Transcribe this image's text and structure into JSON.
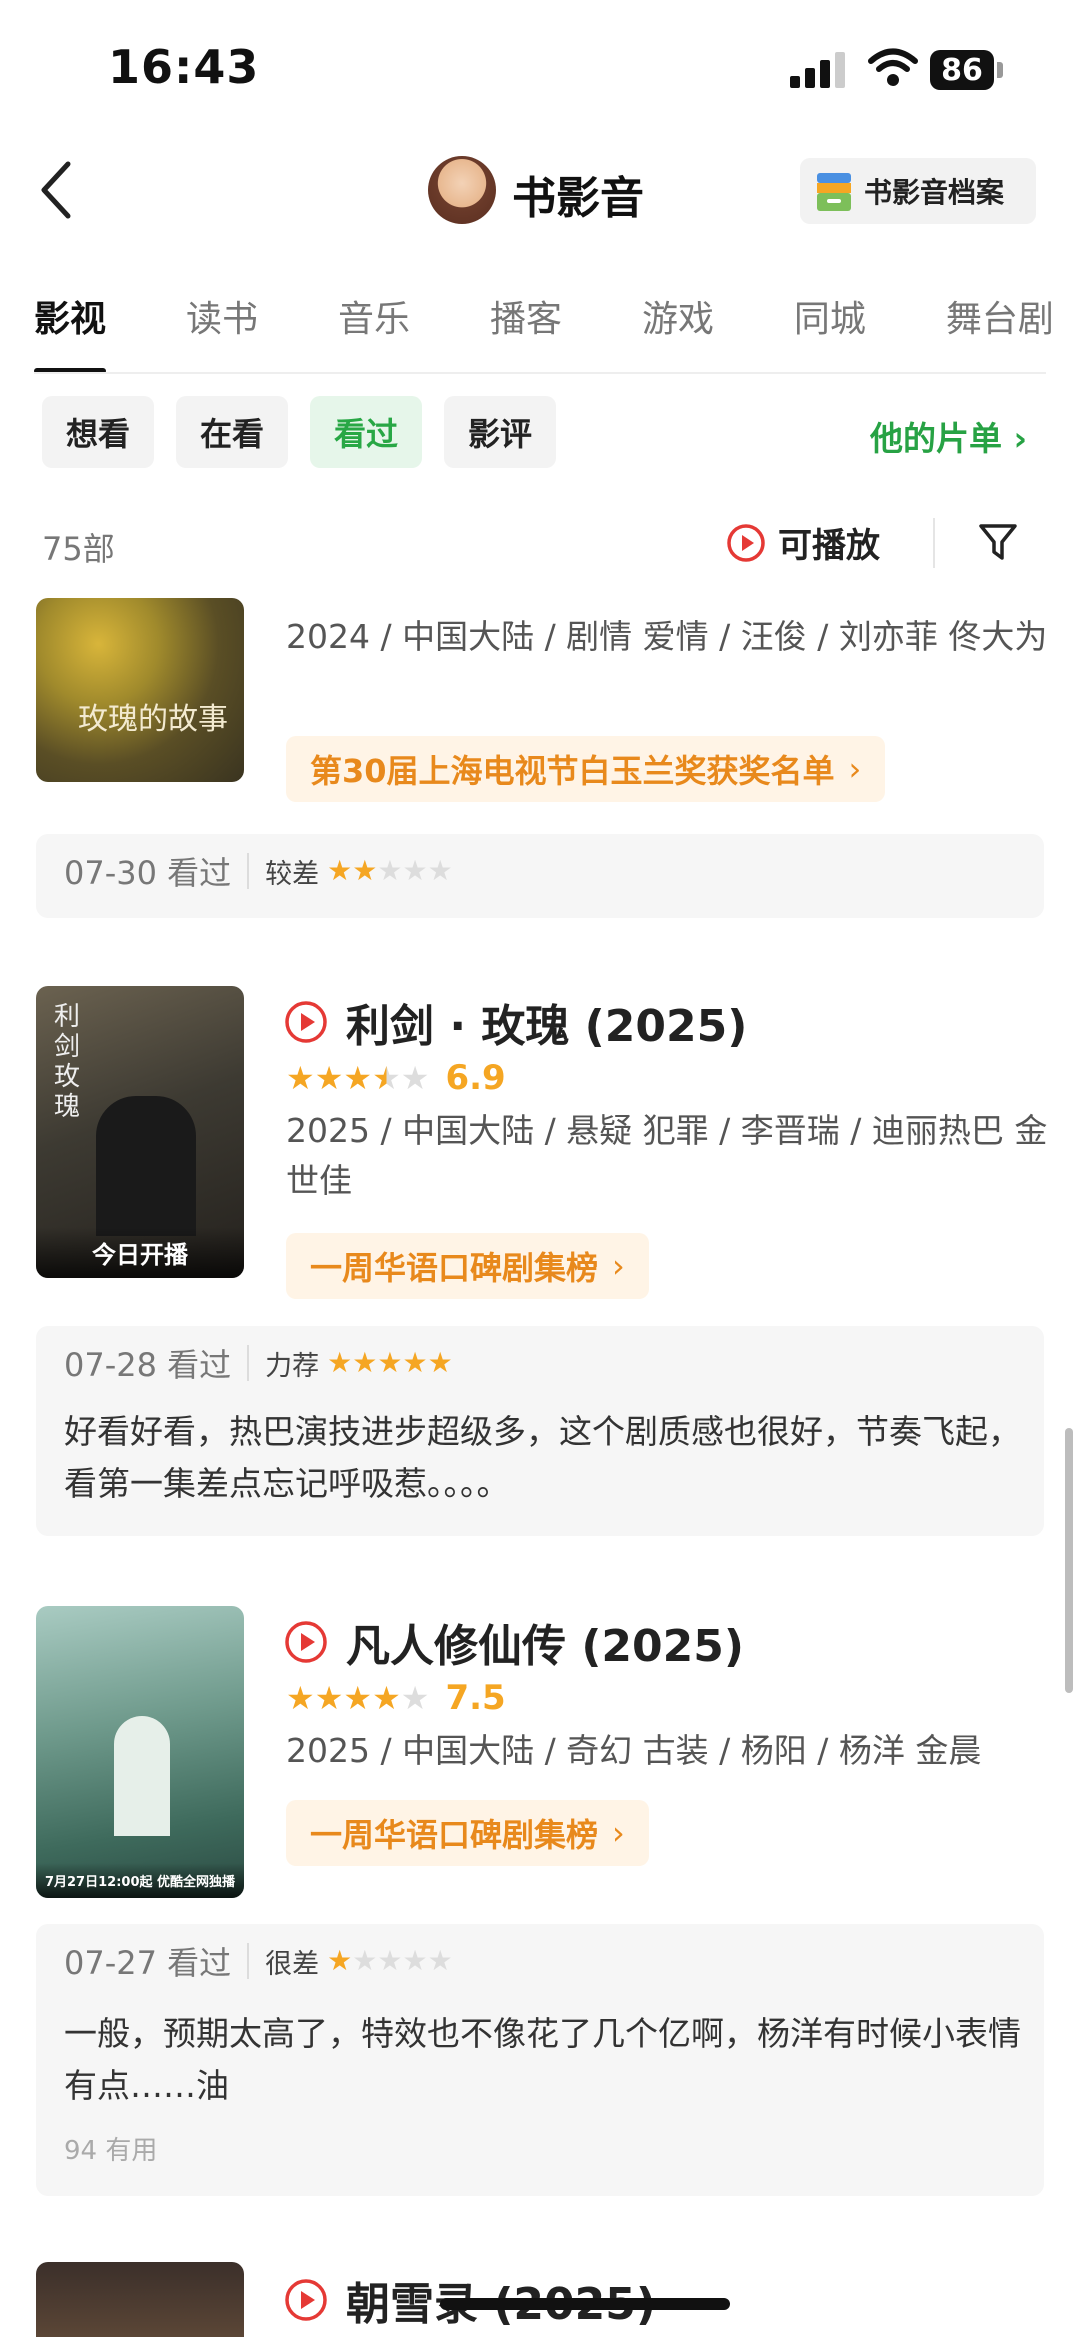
{
  "status_bar": {
    "time": "16:43",
    "battery": "86"
  },
  "header": {
    "title": "书影音",
    "archive_label": "书影音档案"
  },
  "tabs": [
    {
      "label": "影视",
      "active": true
    },
    {
      "label": "读书",
      "active": false
    },
    {
      "label": "音乐",
      "active": false
    },
    {
      "label": "播客",
      "active": false
    },
    {
      "label": "游戏",
      "active": false
    },
    {
      "label": "同城",
      "active": false
    },
    {
      "label": "舞台剧",
      "active": false
    }
  ],
  "filters": {
    "chips": [
      "想看",
      "在看",
      "看过",
      "影评"
    ],
    "selected": "看过",
    "my_list": "他的片单"
  },
  "list_header": {
    "count": "75部",
    "playable": "可播放"
  },
  "items": [
    {
      "poster_text": "玫瑰的故事",
      "meta": "2024 / 中国大陆 / 剧情 爱情 / 汪俊 / 刘亦菲 佟大为",
      "badge": "第30届上海电视节白玉兰奖获奖名单",
      "review": {
        "date": "07-30 看过",
        "level": "较差",
        "user_stars": 2
      }
    },
    {
      "title": "利剑 · 玫瑰 (2025)",
      "stars": 3.5,
      "score": "6.9",
      "poster_text": "利剑玫瑰",
      "poster_caption": "今日开播",
      "meta": "2025 / 中国大陆 / 悬疑 犯罪 / 李晋瑞 / 迪丽热巴 金世佳",
      "badge": "一周华语口碑剧集榜",
      "review": {
        "date": "07-28 看过",
        "level": "力荐",
        "user_stars": 5,
        "text": "好看好看，热巴演技进步超级多，这个剧质感也很好，节奏飞起，看第一集差点忘记呼吸惹。。。。"
      }
    },
    {
      "title": "凡人修仙传 (2025)",
      "stars": 4,
      "score": "7.5",
      "poster_caption": "7月27日12:00起 优酷全网独播",
      "meta": "2025 / 中国大陆 / 奇幻 古装 / 杨阳 / 杨洋 金晨",
      "badge": "一周华语口碑剧集榜",
      "review": {
        "date": "07-27 看过",
        "level": "很差",
        "user_stars": 1,
        "text": "一般，预期太高了，特效也不像花了几个亿啊，杨洋有时候小表情有点……油",
        "useful": "94 有用"
      }
    },
    {
      "title": "朝雪录 (2025)"
    }
  ],
  "colors": {
    "accent_green": "#27a244",
    "star": "#f5a623",
    "badge_text": "#e8891c",
    "play_red": "#e53935"
  }
}
